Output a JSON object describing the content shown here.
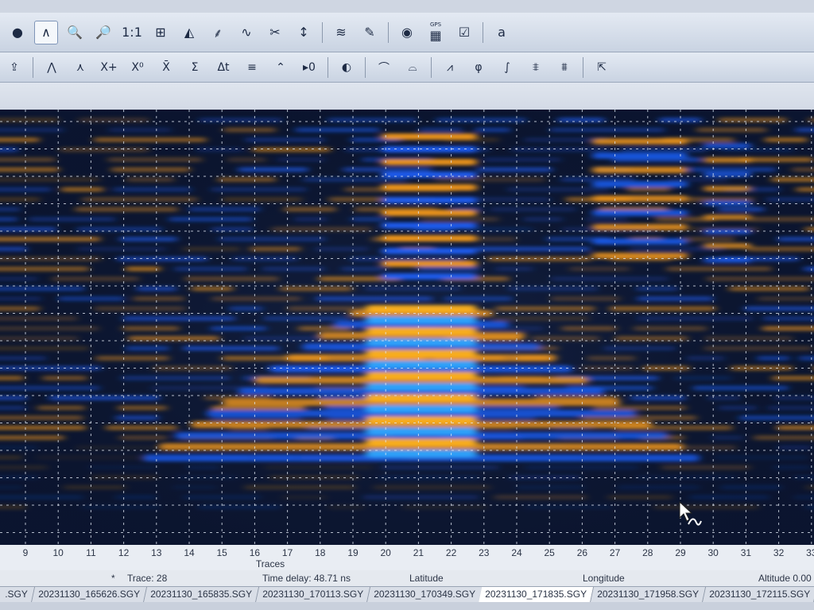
{
  "toolbar_top": {
    "buttons": [
      {
        "id": "point-tool",
        "glyph": "●"
      },
      {
        "id": "wave-tool",
        "glyph": "∧",
        "active": true
      },
      {
        "id": "zoom-in",
        "glyph": "🔍"
      },
      {
        "id": "zoom-out",
        "glyph": "🔎"
      },
      {
        "id": "actual-size",
        "glyph": "1:1"
      },
      {
        "id": "fit-window",
        "glyph": "⊞"
      },
      {
        "id": "amplitude-chart",
        "glyph": "◭"
      },
      {
        "id": "trace-marker",
        "glyph": "⸙"
      },
      {
        "id": "wavelet",
        "glyph": "∿"
      },
      {
        "id": "cut",
        "glyph": "✂"
      },
      {
        "id": "vertical-measure",
        "glyph": "↕"
      },
      {
        "id": "signal",
        "glyph": "≋"
      },
      {
        "id": "edit-folder",
        "glyph": "✎"
      },
      {
        "id": "globe",
        "glyph": "◉"
      },
      {
        "id": "gps",
        "glyph": "▦"
      },
      {
        "id": "report",
        "glyph": "☑"
      },
      {
        "id": "text-settings",
        "glyph": "a"
      }
    ],
    "gps_label": "GPS"
  },
  "toolbar_bottom": {
    "buttons": [
      {
        "id": "import",
        "glyph": "⇪"
      },
      {
        "id": "filter-1",
        "glyph": "⋀"
      },
      {
        "id": "filter-2",
        "glyph": "⋏"
      },
      {
        "id": "x-plus",
        "glyph": "X+"
      },
      {
        "id": "x-zero",
        "glyph": "X⁰"
      },
      {
        "id": "x-bar",
        "glyph": "X̄"
      },
      {
        "id": "sum",
        "glyph": "Σ"
      },
      {
        "id": "delta-t",
        "glyph": "Δt"
      },
      {
        "id": "stack",
        "glyph": "≡"
      },
      {
        "id": "peak",
        "glyph": "⌃"
      },
      {
        "id": "zero-time",
        "glyph": "▸0"
      },
      {
        "id": "color-palette",
        "glyph": "◐"
      },
      {
        "id": "migration-1",
        "glyph": "⌒"
      },
      {
        "id": "migration-2",
        "glyph": "⌓"
      },
      {
        "id": "gain",
        "glyph": "⩘"
      },
      {
        "id": "phase",
        "glyph": "φ"
      },
      {
        "id": "integral",
        "glyph": "∫"
      },
      {
        "id": "bandpass-1",
        "glyph": "⩨"
      },
      {
        "id": "bandpass-2",
        "glyph": "⩩"
      },
      {
        "id": "export",
        "glyph": "⇱"
      }
    ]
  },
  "radargram": {
    "colors": {
      "background": "#0b1530",
      "positive": "#ff9f1a",
      "negative": "#1d62ff",
      "grid": "#dfe6f2"
    }
  },
  "axis": {
    "title": "Traces",
    "ticks": [
      "9",
      "10",
      "11",
      "12",
      "13",
      "14",
      "15",
      "16",
      "17",
      "18",
      "19",
      "20",
      "21",
      "22",
      "23",
      "24",
      "25",
      "26",
      "27",
      "28",
      "29",
      "30",
      "31",
      "32",
      "33"
    ]
  },
  "status": {
    "marker": "*",
    "trace": "Trace: 28",
    "time_delay": "Time delay: 48.71 ns",
    "latitude": "Latitude",
    "longitude": "Longitude",
    "altitude": "Altitude 0.00"
  },
  "file_tabs": [
    {
      "label": ".SGY"
    },
    {
      "label": "20231130_165626.SGY"
    },
    {
      "label": "20231130_165835.SGY"
    },
    {
      "label": "20231130_170113.SGY"
    },
    {
      "label": "20231130_170349.SGY"
    },
    {
      "label": "20231130_171835.SGY",
      "active": true
    },
    {
      "label": "20231130_171958.SGY"
    },
    {
      "label": "20231130_172115.SGY"
    }
  ]
}
